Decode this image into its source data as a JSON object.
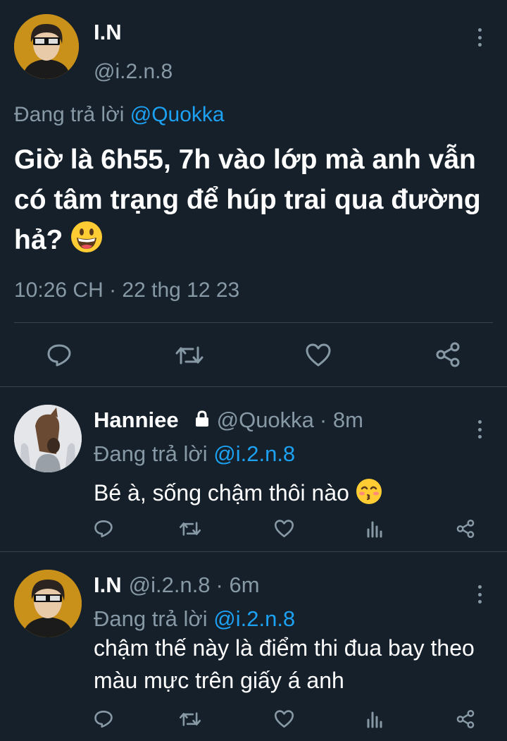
{
  "main_tweet": {
    "name": "I.N",
    "handle": "@i.2.n.8",
    "replying_prefix": "Đang trả lời",
    "replying_to": "@Quokka",
    "text": "Giờ là 6h55, 7h vào lớp mà anh vẫn có tâm trạng để húp trai qua đường hả?",
    "emoji": "grinning-face",
    "timestamp": "10:26 CH · 22 thg 12 23"
  },
  "replies": [
    {
      "name": "Hanniee",
      "protected_icon": "lock-icon",
      "handle": "@Quokka",
      "time": "· 8m",
      "replying_prefix": "Đang trả lời",
      "replying_to": "@i.2.n.8",
      "text": "Bé à, sống chậm thôi nào",
      "emoji": "kissing-face-smiling-eyes"
    },
    {
      "name": "I.N",
      "handle": "@i.2.n.8",
      "time": "· 6m",
      "replying_prefix": "Đang trả lời",
      "replying_to": "@i.2.n.8",
      "text": "chậm thế này là điểm thi đua bay theo màu mực trên giấy á anh"
    }
  ],
  "icons": {
    "reply": "reply-icon",
    "retweet": "retweet-icon",
    "like": "heart-icon",
    "analytics": "analytics-icon",
    "share": "share-icon",
    "more": "more-icon"
  },
  "colors": {
    "background": "#15202b",
    "accent": "#1da1f2",
    "secondary_text": "#8899a6",
    "divider": "#38444d"
  }
}
